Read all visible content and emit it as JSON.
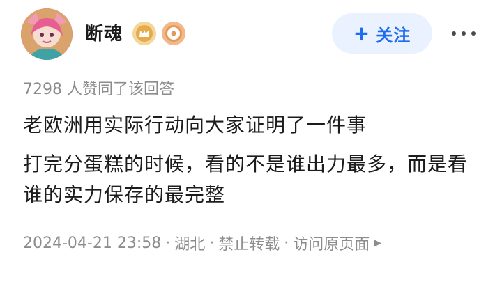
{
  "author": {
    "name": "断魂"
  },
  "follow_button": {
    "plus": "+",
    "label": "关注"
  },
  "likes_text": "7298 人赞同了该回答",
  "content": {
    "paragraph1": "老欧洲用实际行动向大家证明了一件事",
    "paragraph2": "打完分蛋糕的时候，看的不是谁出力最多，而是看谁的实力保存的最完整"
  },
  "meta": {
    "datetime": "2024-04-21 23:58",
    "location": "湖北",
    "copyright": "禁止转载",
    "visit_original": "访问原页面",
    "separator": "·"
  },
  "colors": {
    "accent": "#1f6cf0",
    "follow_bg": "#eaf1ff",
    "muted_text": "#8c8c8c"
  },
  "icons": [
    "avatar-image",
    "crown-badge-icon",
    "eye-badge-icon",
    "more-icon",
    "arrow-right-icon"
  ]
}
